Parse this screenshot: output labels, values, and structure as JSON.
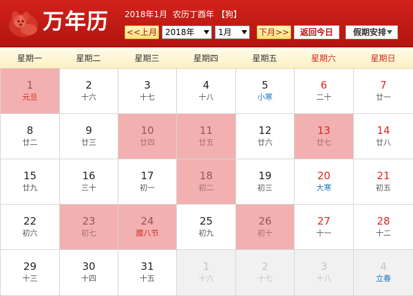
{
  "header": {
    "brand": "万年历",
    "date_label": "2018年1月",
    "lunar_year": "农历丁酉年",
    "zodiac": "【狗】",
    "prev_label": "<<上月",
    "next_label": "下月>>",
    "year_select": "2018年",
    "month_select": "1月",
    "today_label": "返回今日",
    "holiday_label": "假期安排",
    "colors": {
      "bar": "#c01a14",
      "button_bg": "#ffe27a",
      "button_text": "#b4110b"
    }
  },
  "weekdays": [
    {
      "label": "星期一",
      "weekend": false
    },
    {
      "label": "星期二",
      "weekend": false
    },
    {
      "label": "星期三",
      "weekend": false
    },
    {
      "label": "星期四",
      "weekend": false
    },
    {
      "label": "星期五",
      "weekend": false
    },
    {
      "label": "星期六",
      "weekend": true
    },
    {
      "label": "星期日",
      "weekend": true
    }
  ],
  "colors": {
    "weekend_red": "#e3231b",
    "solar_term_blue": "#1a78c2",
    "highlight_pink": "#f3b0b0",
    "other_month_gray": "#f1f1f1"
  },
  "days": [
    {
      "num": "1",
      "lunar": "元旦",
      "highlight": true,
      "type": "fest",
      "weekend": false
    },
    {
      "num": "2",
      "lunar": "十六",
      "weekend": false
    },
    {
      "num": "3",
      "lunar": "十七",
      "weekend": false
    },
    {
      "num": "4",
      "lunar": "十八",
      "weekend": false
    },
    {
      "num": "5",
      "lunar": "小寒",
      "type": "term",
      "weekend": false
    },
    {
      "num": "6",
      "lunar": "二十",
      "weekend": true
    },
    {
      "num": "7",
      "lunar": "廿一",
      "weekend": true
    },
    {
      "num": "8",
      "lunar": "廿二",
      "weekend": false
    },
    {
      "num": "9",
      "lunar": "廿三",
      "weekend": false
    },
    {
      "num": "10",
      "lunar": "廿四",
      "highlight": true,
      "weekend": false
    },
    {
      "num": "11",
      "lunar": "廿五",
      "highlight": true,
      "weekend": false
    },
    {
      "num": "12",
      "lunar": "廿六",
      "weekend": false
    },
    {
      "num": "13",
      "lunar": "廿七",
      "highlight": true,
      "weekend": true
    },
    {
      "num": "14",
      "lunar": "廿八",
      "weekend": true
    },
    {
      "num": "15",
      "lunar": "廿九",
      "weekend": false
    },
    {
      "num": "16",
      "lunar": "三十",
      "weekend": false
    },
    {
      "num": "17",
      "lunar": "初一",
      "weekend": false
    },
    {
      "num": "18",
      "lunar": "初二",
      "highlight": true,
      "weekend": false
    },
    {
      "num": "19",
      "lunar": "初三",
      "weekend": false
    },
    {
      "num": "20",
      "lunar": "大寒",
      "type": "term",
      "weekend": true
    },
    {
      "num": "21",
      "lunar": "初五",
      "weekend": true
    },
    {
      "num": "22",
      "lunar": "初六",
      "weekend": false
    },
    {
      "num": "23",
      "lunar": "初七",
      "highlight": true,
      "weekend": false
    },
    {
      "num": "24",
      "lunar": "腊八节",
      "highlight": true,
      "type": "fest",
      "weekend": false
    },
    {
      "num": "25",
      "lunar": "初九",
      "weekend": false
    },
    {
      "num": "26",
      "lunar": "初十",
      "highlight": true,
      "weekend": false
    },
    {
      "num": "27",
      "lunar": "十一",
      "weekend": true
    },
    {
      "num": "28",
      "lunar": "十二",
      "weekend": true
    },
    {
      "num": "29",
      "lunar": "十三",
      "weekend": false
    },
    {
      "num": "30",
      "lunar": "十四",
      "weekend": false
    },
    {
      "num": "31",
      "lunar": "十五",
      "weekend": false
    },
    {
      "num": "1",
      "lunar": "十六",
      "other_month": true,
      "weekend": false
    },
    {
      "num": "2",
      "lunar": "十七",
      "other_month": true,
      "weekend": false
    },
    {
      "num": "3",
      "lunar": "十八",
      "other_month": true,
      "weekend": true
    },
    {
      "num": "4",
      "lunar": "立春",
      "type": "term",
      "other_month": true,
      "weekend": true
    }
  ]
}
